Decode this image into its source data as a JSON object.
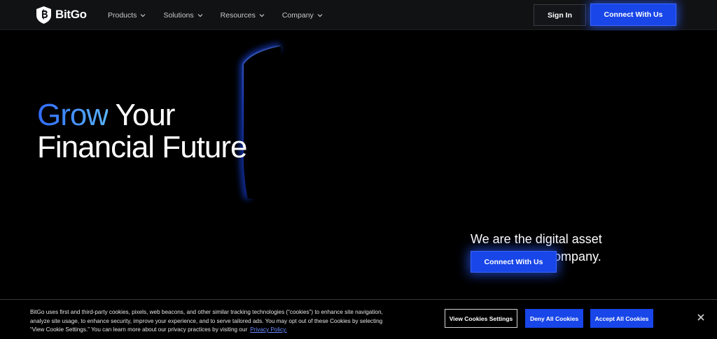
{
  "nav": {
    "brand": "BitGo",
    "menu": [
      {
        "label": "Products"
      },
      {
        "label": "Solutions"
      },
      {
        "label": "Resources"
      },
      {
        "label": "Company"
      }
    ],
    "sign_in_label": "Sign In",
    "connect_label": "Connect With Us"
  },
  "hero": {
    "headline_accent": "Grow",
    "headline_rest_1": " Your",
    "headline_line_2": "Financial Future",
    "tagline_line_1": "We are the digital asset",
    "tagline_line_2": "infrastructure company.",
    "cta_label": "Connect With Us"
  },
  "cookie_banner": {
    "text": "BitGo uses first and third-party cookies, pixels, web beacons, and other similar tracking technologies (“cookies”) to enhance site navigation, analyze site usage, to enhance security, improve your experience, and to serve tailored ads. You may opt out of these Cookies by selecting “View Cookie Settings.” You can learn more about our privacy practices by visiting our",
    "privacy_link": "Privacy Policy.",
    "settings_label": "View Cookies Settings",
    "deny_label": "Deny All Cookies",
    "accept_label": "Accept All Cookies"
  },
  "colors": {
    "accent": "#1846e8",
    "gradient_start": "#2f6bff",
    "gradient_end": "#5ab4ff",
    "nav_bg": "#111214"
  },
  "icons": {
    "logo": "bitgo-shield-icon",
    "menu_chevron": "chevron-down-icon",
    "close": "close-icon"
  }
}
